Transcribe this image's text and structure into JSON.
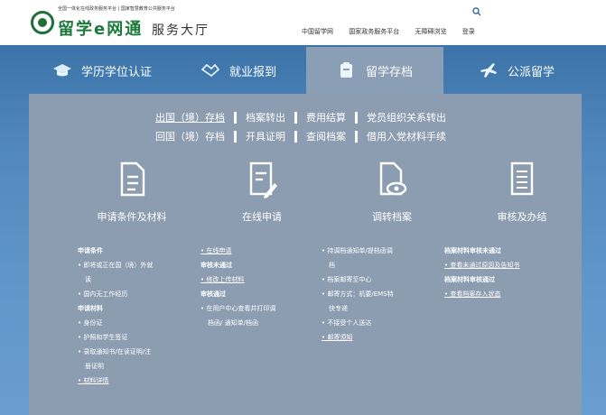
{
  "header": {
    "logo_top_text": "全国一体化在线政务服务平台 | 国家智慧教育公共服务平台",
    "logo_main_text": "留学e网通",
    "logo_sub_text": "服务大厅",
    "links": [
      "中国留学网",
      "国家政务服务平台",
      "无障碍浏览",
      "登录"
    ],
    "search_icon": "search-icon"
  },
  "tabs": [
    {
      "label": "学历学位认证",
      "icon": "graduation-cap-icon"
    },
    {
      "label": "就业报到",
      "icon": "handshake-icon"
    },
    {
      "label": "留学存档",
      "icon": "archive-icon",
      "active": true
    },
    {
      "label": "公派留学",
      "icon": "airplane-icon"
    }
  ],
  "subnav": {
    "row1": [
      "出国（境）存档",
      "档案转出",
      "费用结算",
      "党员组织关系转出"
    ],
    "row2": [
      "回国（境）存档",
      "开具证明",
      "查阅档案",
      "借用入党材料手续"
    ]
  },
  "steps": [
    {
      "label": "申请条件及材料",
      "icon": "document-icon"
    },
    {
      "label": "在线申请",
      "icon": "edit-document-icon"
    },
    {
      "label": "调转档案",
      "icon": "document-view-icon"
    },
    {
      "label": "审核及办结",
      "icon": "checklist-icon"
    }
  ],
  "col1": {
    "h1": "申请条件",
    "i1": "即将或正在国（境）外就",
    "i1b": "读",
    "i2": "国内无工作经历",
    "h2": "申请材料",
    "i3": "身份证",
    "i4": "护照和学生签证",
    "i5": "录取通知书/在读证明/注",
    "i5b": "册证明",
    "i6": "材料详情"
  },
  "col2": {
    "i1": "在线申请",
    "h1": "审核未通过",
    "i2": "修改上传材料",
    "h2": "审核通过",
    "i3": "在用户中心查看并打印调",
    "i3b": "档函/ 通知单/档函"
  },
  "col3": {
    "i1": "持调档通知单/提档函调",
    "i1b": "档",
    "i2": "档案邮寄至中心",
    "i3": "邮寄方式：机要/EMS特",
    "i3b": "快专递",
    "i4": "不接受个人送达",
    "i5": "邮寄须知"
  },
  "col4": {
    "h1": "档案材料审核未通过",
    "i1": "查看未通过原因及告知书",
    "h2": "档案材料审核通过",
    "i2": "查看档案存入状态"
  }
}
